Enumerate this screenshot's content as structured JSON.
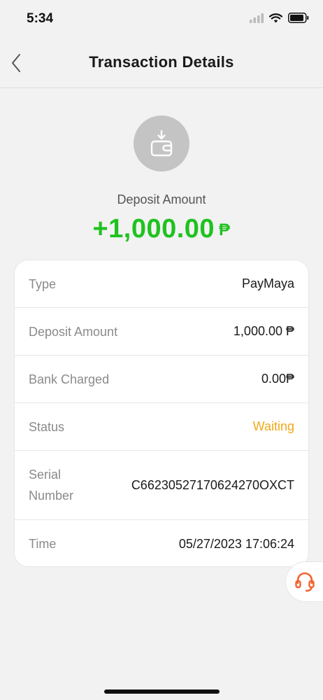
{
  "status_bar": {
    "time": "5:34"
  },
  "nav": {
    "title": "Transaction Details"
  },
  "summary": {
    "label": "Deposit Amount",
    "amount": "+1,000.00",
    "currency": "₱",
    "amount_color": "#1fc21f"
  },
  "details": {
    "type": {
      "label": "Type",
      "value": "PayMaya"
    },
    "deposit_amount": {
      "label": "Deposit Amount",
      "value": "1,000.00 ₱"
    },
    "bank_charged": {
      "label": "Bank Charged",
      "value": "0.00₱"
    },
    "status": {
      "label": "Status",
      "value": "Waiting",
      "color": "#f0a818"
    },
    "serial_number": {
      "label": "Serial Number",
      "value": "C66230527170624270OXCT"
    },
    "time": {
      "label": "Time",
      "value": "05/27/2023 17:06:24"
    }
  },
  "icons": {
    "back": "chevron-left-icon",
    "wallet": "wallet-deposit-icon",
    "support": "headset-icon"
  }
}
